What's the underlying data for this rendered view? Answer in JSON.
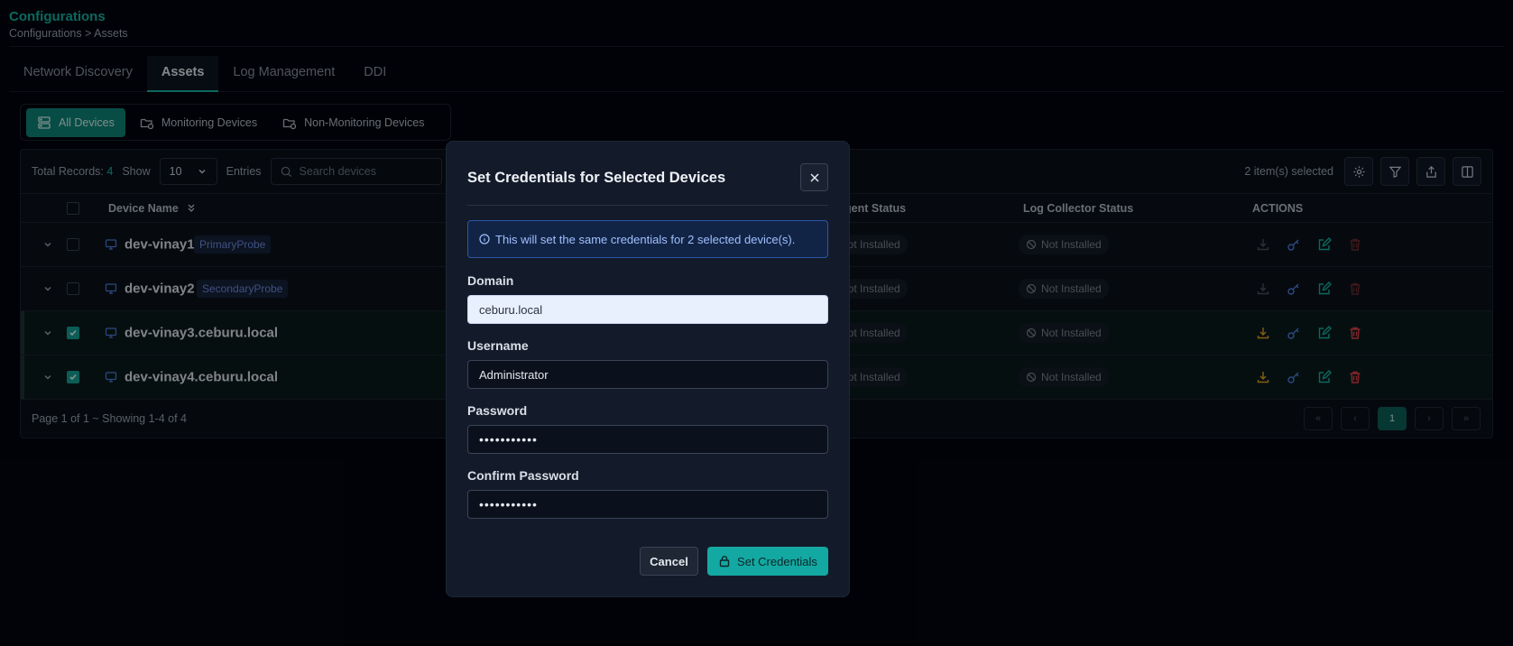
{
  "page": {
    "title": "Configurations",
    "breadcrumb": "Configurations > Assets"
  },
  "tabs": [
    {
      "label": "Network Discovery",
      "active": false
    },
    {
      "label": "Assets",
      "active": true
    },
    {
      "label": "Log Management",
      "active": false
    },
    {
      "label": "DDI",
      "active": false
    }
  ],
  "segments": [
    {
      "label": "All Devices",
      "icon": "server-icon",
      "active": true
    },
    {
      "label": "Monitoring Devices",
      "icon": "folder-monitor-icon",
      "active": false
    },
    {
      "label": "Non-Monitoring Devices",
      "icon": "folder-monitor-icon",
      "active": false
    }
  ],
  "toolbar": {
    "total_label": "Total Records:",
    "total_count": "4",
    "show_label": "Show",
    "show_value": "10",
    "entries_label": "Entries",
    "search_placeholder": "Search devices",
    "selected_text": "2 item(s) selected"
  },
  "table": {
    "headers": {
      "device_name": "Device Name",
      "agent_status": "Agent Status",
      "log_status": "Log Collector Status",
      "actions": "ACTIONS"
    },
    "rows": [
      {
        "name": "dev-vinay1",
        "badge": "PrimaryProbe",
        "checked": false,
        "agent": "Not Installed",
        "log": "Not Installed"
      },
      {
        "name": "dev-vinay2",
        "badge": "SecondaryProbe",
        "checked": false,
        "agent": "Not Installed",
        "log": "Not Installed"
      },
      {
        "name": "dev-vinay3.ceburu.local",
        "badge": "",
        "checked": true,
        "agent": "Not Installed",
        "log": "Not Installed"
      },
      {
        "name": "dev-vinay4.ceburu.local",
        "badge": "",
        "checked": true,
        "agent": "Not Installed",
        "log": "Not Installed"
      }
    ],
    "footer": "Page 1 of 1 ~ Showing 1-4 of 4",
    "current_page": "1"
  },
  "modal": {
    "title": "Set Credentials for Selected Devices",
    "info": "This will set the same credentials for 2 selected device(s).",
    "domain_label": "Domain",
    "domain_value": "ceburu.local",
    "username_label": "Username",
    "username_value": "Administrator",
    "password_label": "Password",
    "password_value": "•••••••••••",
    "confirm_label": "Confirm Password",
    "confirm_value": "•••••••••••",
    "cancel_label": "Cancel",
    "submit_label": "Set Credentials"
  },
  "colors": {
    "accent": "#14b3a3",
    "download_active": "#e0a21a",
    "key": "#4b7fe0",
    "edit": "#14b3a3",
    "delete": "#e0434b"
  }
}
